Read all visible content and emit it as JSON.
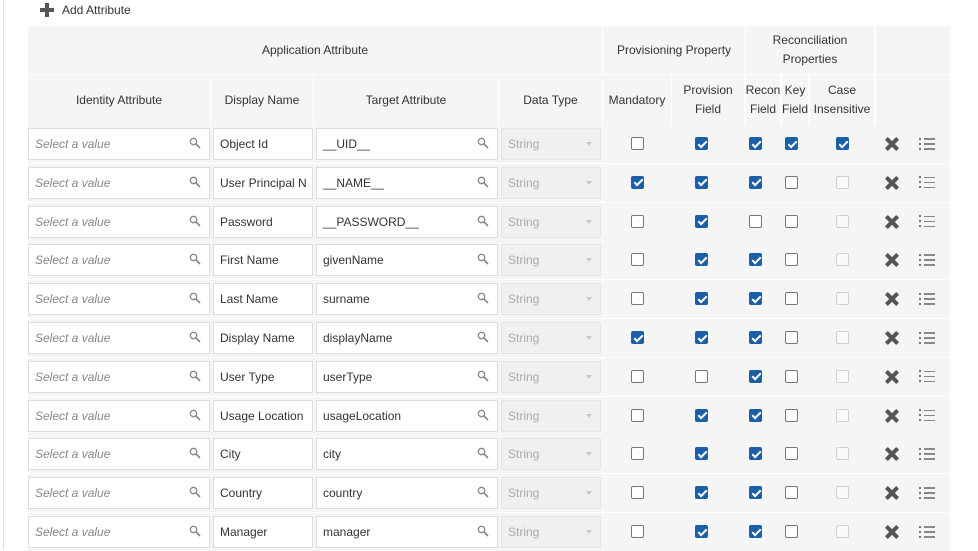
{
  "toolbar": {
    "add_label": "Add Attribute"
  },
  "headers": {
    "group_application": "Application Attribute",
    "group_provisioning": "Provisioning Property",
    "group_reconciliation": "Reconciliation Properties",
    "identity_attribute": "Identity Attribute",
    "display_name": "Display Name",
    "target_attribute": "Target Attribute",
    "data_type": "Data Type",
    "mandatory": "Mandatory",
    "provision_field": "Provision Field",
    "recon_field": "Recon Field",
    "key_field": "Key Field",
    "case_insensitive": "Case Insensitive"
  },
  "identity_placeholder": "Select a value",
  "rows": [
    {
      "display_name": "Object Id",
      "target": "__UID__",
      "data_type": "String",
      "mandatory": false,
      "provision": true,
      "recon": true,
      "key": true,
      "case_insensitive": true
    },
    {
      "display_name": "User Principal N",
      "target": "__NAME__",
      "data_type": "String",
      "mandatory": true,
      "provision": true,
      "recon": true,
      "key": false,
      "case_insensitive": false
    },
    {
      "display_name": "Password",
      "target": "__PASSWORD__",
      "data_type": "String",
      "mandatory": false,
      "provision": true,
      "recon": false,
      "key": false,
      "case_insensitive": false
    },
    {
      "display_name": "First Name",
      "target": "givenName",
      "data_type": "String",
      "mandatory": false,
      "provision": true,
      "recon": true,
      "key": false,
      "case_insensitive": false
    },
    {
      "display_name": "Last Name",
      "target": "surname",
      "data_type": "String",
      "mandatory": false,
      "provision": true,
      "recon": true,
      "key": false,
      "case_insensitive": false
    },
    {
      "display_name": "Display Name",
      "target": "displayName",
      "data_type": "String",
      "mandatory": true,
      "provision": true,
      "recon": true,
      "key": false,
      "case_insensitive": false
    },
    {
      "display_name": "User Type",
      "target": "userType",
      "data_type": "String",
      "mandatory": false,
      "provision": false,
      "recon": true,
      "key": false,
      "case_insensitive": false
    },
    {
      "display_name": "Usage Location",
      "target": "usageLocation",
      "data_type": "String",
      "mandatory": false,
      "provision": true,
      "recon": true,
      "key": false,
      "case_insensitive": false
    },
    {
      "display_name": "City",
      "target": "city",
      "data_type": "String",
      "mandatory": false,
      "provision": true,
      "recon": true,
      "key": false,
      "case_insensitive": false
    },
    {
      "display_name": "Country",
      "target": "country",
      "data_type": "String",
      "mandatory": false,
      "provision": true,
      "recon": true,
      "key": false,
      "case_insensitive": false
    },
    {
      "display_name": "Manager",
      "target": "manager",
      "data_type": "String",
      "mandatory": false,
      "provision": true,
      "recon": true,
      "key": false,
      "case_insensitive": false
    }
  ]
}
